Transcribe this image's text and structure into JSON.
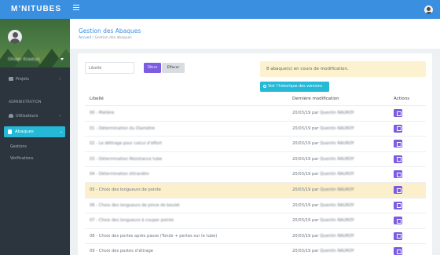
{
  "topbar": {
    "logo_main": "M’NITUBES",
    "logo_accent": "",
    "brand_color": "#3a8fe0"
  },
  "sidebar": {
    "profile_name": "Olivier Kradrys",
    "nav": {
      "projets": "Projets",
      "section_admin": "ADMINISTRATION",
      "utilisateurs": "Utilisateurs",
      "abaques": "Abaques",
      "gestions": "Gestions",
      "verifications": "Vérifications"
    },
    "active_color": "#25b9d7"
  },
  "header": {
    "title": "Gestion des Abaques",
    "breadcrumb_home": "Accueil",
    "breadcrumb_current": "Gestion des abaques",
    "breadcrumb_sep": "/"
  },
  "filter": {
    "placeholder": "Libellé",
    "filter_label": "Filtrer",
    "clear_label": "Effacer"
  },
  "alert": {
    "text": "8 abaque(s) en cours de modification."
  },
  "history_button": {
    "label": "Voir l’historique des versions"
  },
  "table": {
    "headers": {
      "libelle": "Libellé",
      "modification": "Dernière modification",
      "actions": "Actions"
    },
    "rows": [
      {
        "libelle": "00 - Matière",
        "date": "20/03/19 par",
        "author": "Quentin RAUROY",
        "highlight": false,
        "blurred": true
      },
      {
        "libelle": "01 - Détermination du Diamètre",
        "date": "20/03/19 par",
        "author": "Quentin RAUROY",
        "highlight": false,
        "blurred": true
      },
      {
        "libelle": "02 - Le détirage pour calcul d’effort",
        "date": "20/03/19 par",
        "author": "Quentin RAUROY",
        "highlight": false,
        "blurred": true
      },
      {
        "libelle": "03 - Détermination Résistance tube",
        "date": "20/03/19 par",
        "author": "Quentin RAUROY",
        "highlight": false,
        "blurred": true
      },
      {
        "libelle": "04 - Détermination étirandim",
        "date": "20/03/19 par",
        "author": "Quentin RAUROY",
        "highlight": false,
        "blurred": true
      },
      {
        "libelle": "05 - Choix des longueurs de pointe",
        "date": "20/03/19 par",
        "author": "Quentin RAUROY",
        "highlight": true,
        "blurred": false
      },
      {
        "libelle": "06 - Choix des longueurs de pince de boulet",
        "date": "20/03/19 par",
        "author": "Quentin RAUROY",
        "highlight": false,
        "blurred": true
      },
      {
        "libelle": "07 - Choix des longueurs à couper pointe",
        "date": "20/03/19 par",
        "author": "Quentin RAUROY",
        "highlight": false,
        "blurred": true
      },
      {
        "libelle": "08 - Choix des portes après passe (Tonds + pertes sur le tube)",
        "date": "20/03/19 par",
        "author": "Quentin RAUROY",
        "highlight": false,
        "blurred": false
      },
      {
        "libelle": "09 - Choix des postes d’étirage",
        "date": "20/03/19 par",
        "author": "Quentin RAUROY",
        "highlight": false,
        "blurred": false
      }
    ]
  }
}
